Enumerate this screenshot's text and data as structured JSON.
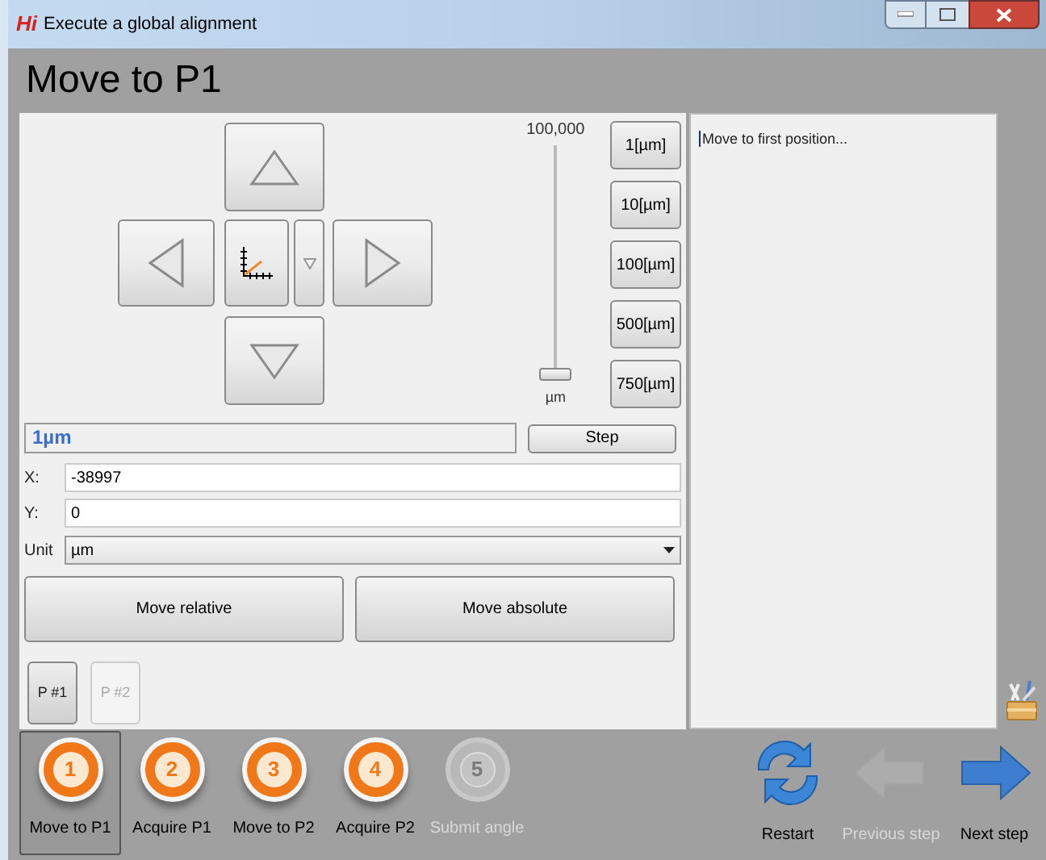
{
  "window": {
    "title": "Execute a global alignment",
    "logo": "Hi"
  },
  "heading": "Move to P1",
  "jog_buttons": [
    {
      "kind": "up"
    },
    {
      "kind": "left"
    },
    {
      "kind": "origin"
    },
    {
      "kind": "dropdown"
    },
    {
      "kind": "right"
    },
    {
      "kind": "down"
    }
  ],
  "slider": {
    "max_label": "100,000",
    "unit": "µm",
    "level": 0.0
  },
  "step_presets": [
    "1[µm]",
    "10[µm]",
    "100[µm]",
    "500[µm]",
    "750[µm]"
  ],
  "step_display": "1µm",
  "step_button": "Step",
  "fields": [
    {
      "label": "X:",
      "value": "-38997"
    },
    {
      "label": "Y:",
      "value": "0"
    }
  ],
  "unit": {
    "label": "Unit",
    "value": "µm"
  },
  "move_buttons": [
    "Move relative",
    "Move absolute"
  ],
  "points": [
    {
      "label": "P #1",
      "disabled": false
    },
    {
      "label": "P #2",
      "disabled": true
    }
  ],
  "log": "Move to first position...",
  "steps": [
    {
      "number": "1",
      "label": "Move to P1",
      "selected": true,
      "disabled": false
    },
    {
      "number": "2",
      "label": "Acquire P1",
      "selected": false,
      "disabled": false
    },
    {
      "number": "3",
      "label": "Move to P2",
      "selected": false,
      "disabled": false
    },
    {
      "number": "4",
      "label": "Acquire P2",
      "selected": false,
      "disabled": false
    },
    {
      "number": "5",
      "label": "Submit angle",
      "selected": false,
      "disabled": true
    }
  ],
  "nav": [
    {
      "kind": "restart",
      "label": "Restart",
      "disabled": false
    },
    {
      "kind": "previous",
      "label": "Previous step",
      "disabled": true
    },
    {
      "kind": "next",
      "label": "Next step",
      "disabled": false
    }
  ]
}
